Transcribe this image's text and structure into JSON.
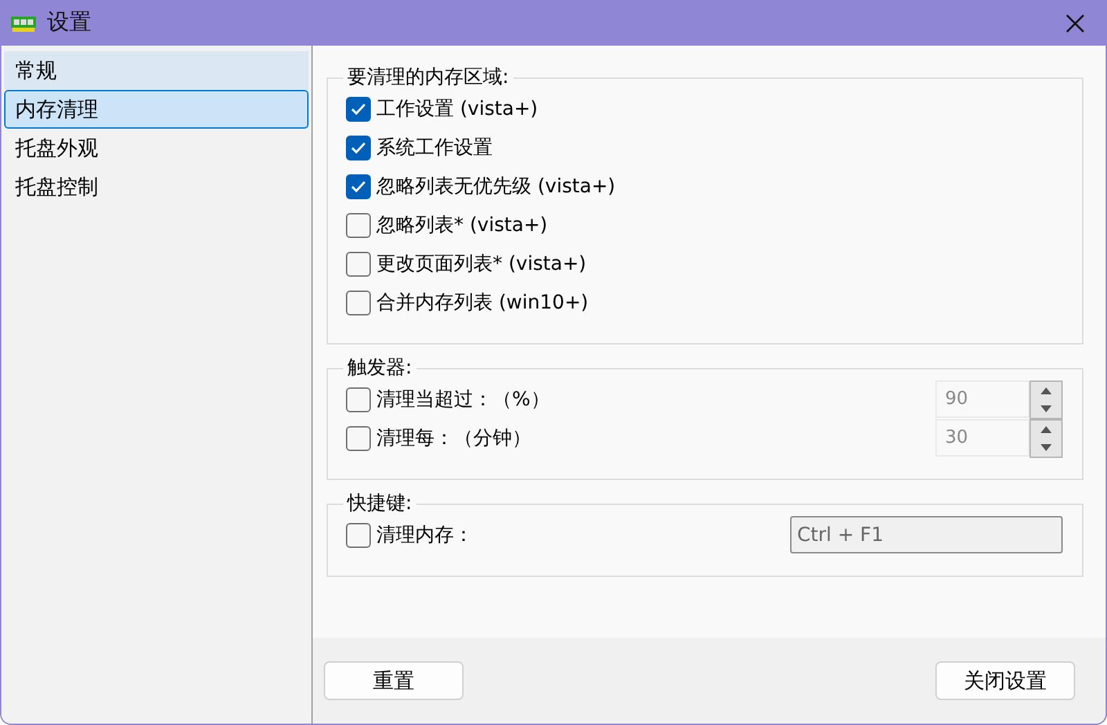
{
  "window": {
    "title": "设置"
  },
  "sidebar": {
    "items": [
      {
        "label": "常规",
        "selected": false,
        "highlighted": true
      },
      {
        "label": "内存清理",
        "selected": true,
        "highlighted": false
      },
      {
        "label": "托盘外观",
        "selected": false,
        "highlighted": false
      },
      {
        "label": "托盘控制",
        "selected": false,
        "highlighted": false
      }
    ]
  },
  "areas": {
    "title": "要清理的内存区域:",
    "options": [
      {
        "label": "工作设置 (vista+)",
        "checked": true
      },
      {
        "label": "系统工作设置",
        "checked": true
      },
      {
        "label": "忽略列表无优先级 (vista+)",
        "checked": true
      },
      {
        "label": "忽略列表* (vista+)",
        "checked": false
      },
      {
        "label": "更改页面列表* (vista+)",
        "checked": false
      },
      {
        "label": "合并内存列表 (win10+)",
        "checked": false
      }
    ]
  },
  "triggers": {
    "title": "触发器:",
    "rows": [
      {
        "label": "清理当超过：（%）",
        "checked": false,
        "value": "90"
      },
      {
        "label": "清理每：（分钟）",
        "checked": false,
        "value": "30"
      }
    ]
  },
  "hotkeys": {
    "title": "快捷键:",
    "rows": [
      {
        "label": "清理内存：",
        "checked": false,
        "value": "Ctrl + F1"
      }
    ]
  },
  "buttons": {
    "reset": "重置",
    "close": "关闭设置"
  }
}
